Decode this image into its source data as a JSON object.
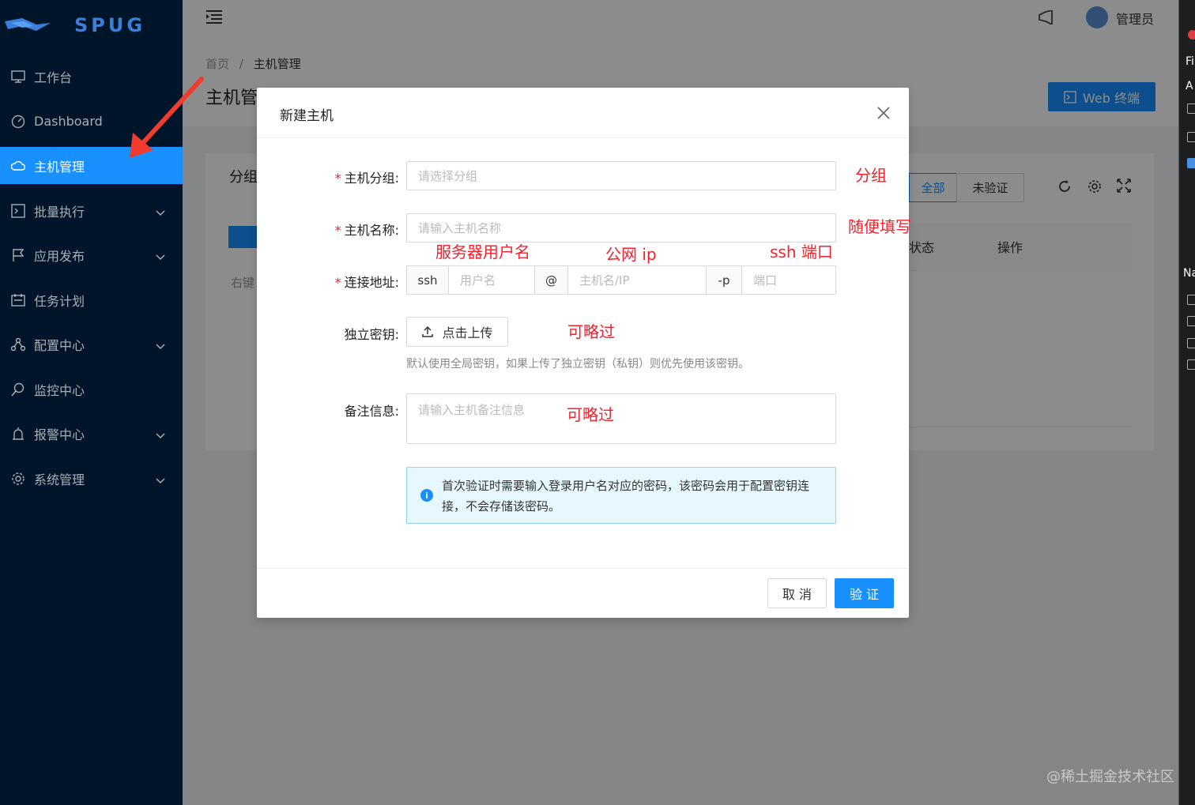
{
  "app": {
    "logo_text": "SPUG"
  },
  "sidebar": {
    "items": [
      {
        "label": "工作台",
        "icon": "desktop-icon"
      },
      {
        "label": "Dashboard",
        "icon": "dashboard-icon"
      },
      {
        "label": "主机管理",
        "icon": "cloud-icon",
        "active": true
      },
      {
        "label": "批量执行",
        "icon": "code-icon",
        "has_children": true
      },
      {
        "label": "应用发布",
        "icon": "flag-icon",
        "has_children": true
      },
      {
        "label": "任务计划",
        "icon": "schedule-icon"
      },
      {
        "label": "配置中心",
        "icon": "deployment-icon",
        "has_children": true
      },
      {
        "label": "监控中心",
        "icon": "monitor-icon"
      },
      {
        "label": "报警中心",
        "icon": "alarm-icon",
        "has_children": true
      },
      {
        "label": "系统管理",
        "icon": "setting-icon",
        "has_children": true
      }
    ]
  },
  "header": {
    "user": "管理员"
  },
  "breadcrumb": {
    "home": "首页",
    "sep": "/",
    "current": "主机管理"
  },
  "page": {
    "title": "主机管",
    "web_terminal_label": "Web 终端",
    "card_title": "分组",
    "filter_all": "全部",
    "filter_unverified": "未验证",
    "col_status": "状态",
    "col_actions": "操作",
    "right_click_hint": "右键"
  },
  "modal": {
    "title": "新建主机",
    "fields": {
      "group_label": "主机分组:",
      "group_placeholder": "请选择分组",
      "name_label": "主机名称:",
      "name_placeholder": "请输入主机名称",
      "addr_label": "连接地址:",
      "addr_prefix": "ssh",
      "user_placeholder": "用户名",
      "at": "@",
      "host_placeholder": "主机名/IP",
      "port_prefix": "-p",
      "port_placeholder": "端口",
      "key_label": "独立密钥:",
      "upload_label": "点击上传",
      "key_hint": "默认使用全局密钥，如果上传了独立密钥（私钥）则优先使用该密钥。",
      "desc_label": "备注信息:",
      "desc_placeholder": "请输入主机备注信息"
    },
    "alert": "首次验证时需要输入登录用户名对应的密码，该密码会用于配置密钥连接，不会存储该密码。",
    "cancel_label": "取 消",
    "ok_label": "验 证"
  },
  "annotations": {
    "group": "分组",
    "name": "随便填写",
    "user": "服务器用户名",
    "ip": "公网 ip",
    "port": "ssh 端口",
    "key_skip": "可略过",
    "desc_skip": "可略过"
  },
  "right_panel": {
    "t1": "Fi",
    "t2": "A",
    "t3": "Na"
  },
  "watermark": "@稀土掘金技术社区",
  "colors": {
    "primary": "#1890ff",
    "sidebar": "#001529",
    "annotation": "#f5222d"
  }
}
